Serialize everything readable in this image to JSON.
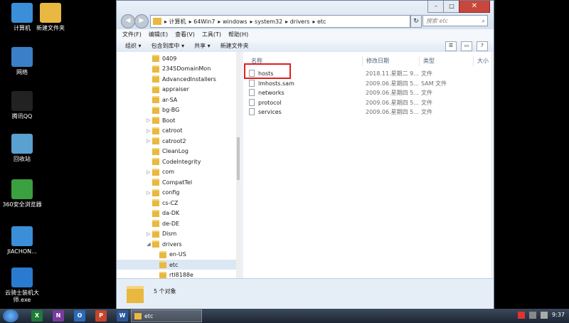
{
  "desktop": {
    "icons": [
      {
        "label": "计算机",
        "icon": "computer-icon"
      },
      {
        "label": "新建文件夹",
        "icon": "folder-icon"
      },
      {
        "label": "网络",
        "icon": "network-icon"
      },
      {
        "label": "腾讯QQ",
        "icon": "qq-icon"
      },
      {
        "label": "回收站",
        "icon": "recycle-bin-icon"
      },
      {
        "label": "360安全浏览器",
        "icon": "browser-360-icon"
      },
      {
        "label": "JIACHON...",
        "icon": "computer-icon"
      },
      {
        "label": "云骑士装机大师.exe",
        "icon": "installer-icon"
      }
    ]
  },
  "window": {
    "address": {
      "crumbs": [
        "计算机",
        "64Win7",
        "windows",
        "system32",
        "drivers",
        "etc"
      ]
    },
    "search_placeholder": "搜索 etc",
    "menu": [
      "文件(F)",
      "编辑(E)",
      "查看(V)",
      "工具(T)",
      "帮助(H)"
    ],
    "toolbar": [
      "组织 ▾",
      "包含到库中 ▾",
      "共享 ▾",
      "新建文件夹"
    ],
    "tree": [
      {
        "label": "0409",
        "arrow": ""
      },
      {
        "label": "2345DomainMon",
        "arrow": ""
      },
      {
        "label": "AdvancedInstallers",
        "arrow": ""
      },
      {
        "label": "appraiser",
        "arrow": ""
      },
      {
        "label": "ar-SA",
        "arrow": ""
      },
      {
        "label": "bg-BG",
        "arrow": ""
      },
      {
        "label": "Boot",
        "arrow": "▷"
      },
      {
        "label": "catroot",
        "arrow": "▷"
      },
      {
        "label": "catroot2",
        "arrow": "▷"
      },
      {
        "label": "CleanLog",
        "arrow": ""
      },
      {
        "label": "CodeIntegrity",
        "arrow": ""
      },
      {
        "label": "com",
        "arrow": "▷"
      },
      {
        "label": "CompatTel",
        "arrow": ""
      },
      {
        "label": "config",
        "arrow": "▷"
      },
      {
        "label": "cs-CZ",
        "arrow": ""
      },
      {
        "label": "da-DK",
        "arrow": ""
      },
      {
        "label": "de-DE",
        "arrow": ""
      },
      {
        "label": "Dism",
        "arrow": "▷"
      },
      {
        "label": "drivers",
        "arrow": "◢"
      },
      {
        "label": "en-US",
        "arrow": ""
      },
      {
        "label": "etc",
        "arrow": ""
      },
      {
        "label": "rtl8188e",
        "arrow": ""
      }
    ],
    "columns": [
      "名称",
      "修改日期",
      "类型",
      "大小"
    ],
    "files": [
      {
        "name": "hosts",
        "date": "2018.11.星期二 9...",
        "type": "文件"
      },
      {
        "name": "lmhosts.sam",
        "date": "2009.06.星期四 5...",
        "type": "SAM 文件"
      },
      {
        "name": "networks",
        "date": "2009.06.星期四 5...",
        "type": "文件"
      },
      {
        "name": "protocol",
        "date": "2009.06.星期四 5...",
        "type": "文件"
      },
      {
        "name": "services",
        "date": "2009.06.星期四 5...",
        "type": "文件"
      }
    ],
    "status": "5 个对象"
  },
  "taskbar": {
    "apps": [
      {
        "label": "X",
        "color": "#1f7a3a",
        "icon": "excel-icon"
      },
      {
        "label": "N",
        "color": "#7a3aa0",
        "icon": "onenote-icon"
      },
      {
        "label": "O",
        "color": "#2a6ab8",
        "icon": "outlook-icon"
      },
      {
        "label": "P",
        "color": "#c4452a",
        "icon": "powerpoint-icon"
      },
      {
        "label": "W",
        "color": "#2b579a",
        "icon": "word-icon"
      }
    ],
    "task_label": "etc",
    "clock": "9:37"
  }
}
